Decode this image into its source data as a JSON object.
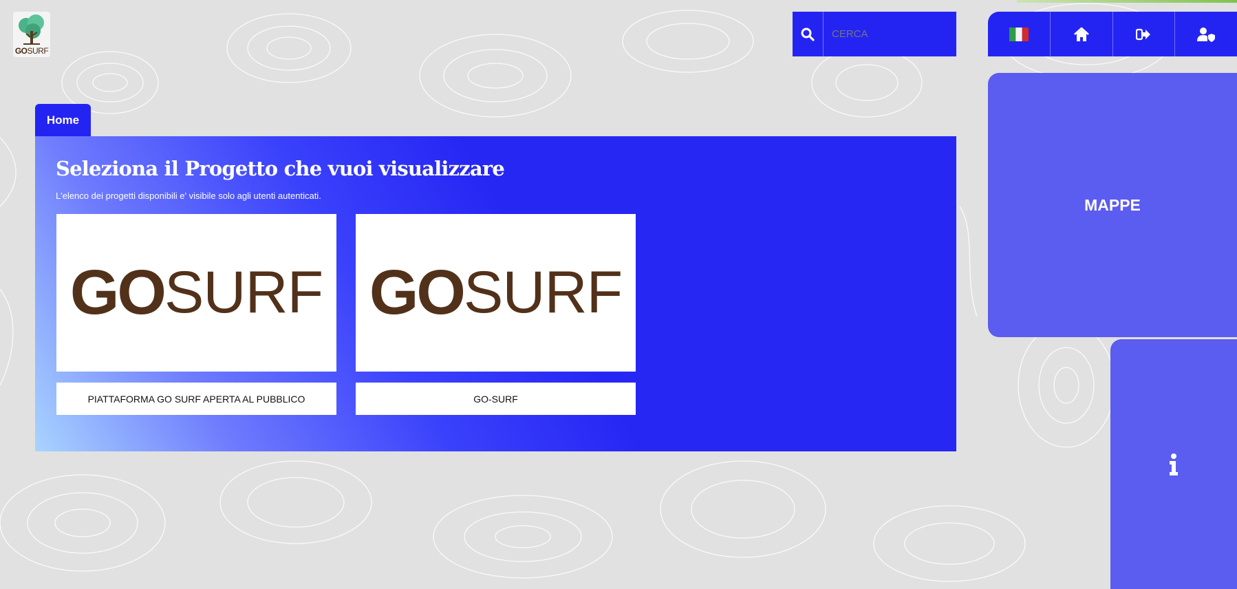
{
  "app": {
    "logo": {
      "text_go": "GO",
      "text_surf": "SURF"
    }
  },
  "search": {
    "placeholder": "CERCA"
  },
  "nav": {
    "items": [
      {
        "name": "language-flag-icon",
        "icon": "italian-flag"
      },
      {
        "name": "home-icon",
        "icon": "home"
      },
      {
        "name": "logout-icon",
        "icon": "sign-out"
      },
      {
        "name": "user-shield-icon",
        "icon": "user-shield"
      }
    ]
  },
  "side": {
    "mappe_label": "MAPPE",
    "info_icon": "info-icon"
  },
  "breadcrumb": {
    "home": "Home"
  },
  "main": {
    "title": "Seleziona il Progetto che vuoi visualizzare",
    "subtitle": "L'elenco dei progetti disponibili e' visibile solo agli utenti autenticati.",
    "projects": [
      {
        "logo_bold": "GO",
        "logo_light": "SURF",
        "caption": "PIATTAFORMA GO SURF APERTA AL PUBBLICO"
      },
      {
        "logo_bold": "GO",
        "logo_light": "SURF",
        "caption": "GO-SURF"
      }
    ]
  },
  "colors": {
    "accent": "#2424f2",
    "side_panel": "#5b5cf0",
    "logo_brown": "#52311a",
    "background": "#e1e1e1"
  }
}
